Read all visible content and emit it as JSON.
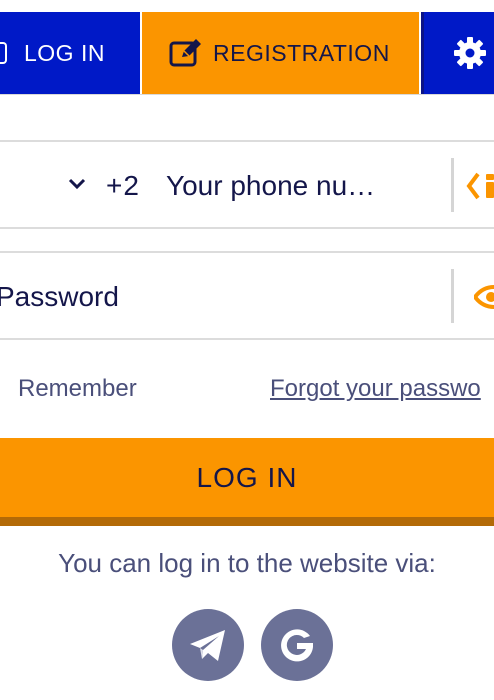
{
  "tabs": {
    "login_label": "LOG IN",
    "registration_label": "REGISTRATION",
    "login_icon": "login-icon",
    "registration_icon": "edit-icon",
    "settings_icon": "gear-icon"
  },
  "phone": {
    "country_code": "+2",
    "placeholder": "Your phone nu…",
    "dropdown_icon": "chevron-down-icon",
    "action_icon": "code-icon"
  },
  "password": {
    "placeholder": "Password",
    "toggle_icon": "eye-icon"
  },
  "options": {
    "remember_label": "Remember",
    "forgot_label": "Forgot your passwo"
  },
  "login_button": {
    "label": "LOG IN"
  },
  "social": {
    "label": "You can log in to the website via:",
    "items": [
      {
        "name": "telegram",
        "icon": "telegram-icon"
      },
      {
        "name": "google",
        "icon": "google-icon"
      }
    ]
  },
  "colors": {
    "brand_blue": "#0019c7",
    "accent_orange": "#fb9500",
    "button_shadow": "#b36a07",
    "text_dark": "#14164a",
    "text_muted": "#4a4f7a",
    "social_bg": "#6b7197"
  }
}
